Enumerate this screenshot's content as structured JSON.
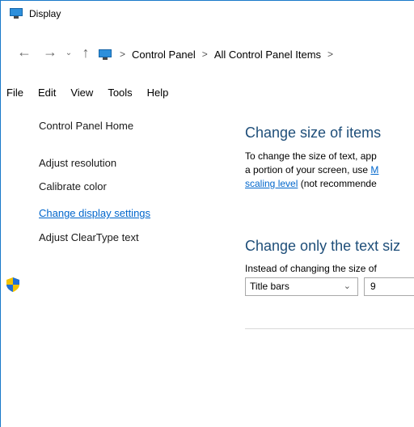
{
  "window": {
    "title": "Display"
  },
  "address": {
    "crumbs": [
      "Control Panel",
      "All Control Panel Items"
    ],
    "separator": ">"
  },
  "nav": {
    "back": "←",
    "forward": "→",
    "recent": "⌄",
    "up": "↑"
  },
  "menu": [
    "File",
    "Edit",
    "View",
    "Tools",
    "Help"
  ],
  "sidebar": {
    "home": "Control Panel Home",
    "items": [
      "Adjust resolution",
      "Calibrate color",
      "Change display settings",
      "Adjust ClearType text"
    ]
  },
  "main": {
    "section1": {
      "heading": "Change size of items",
      "line1": "To change the size of text, app",
      "line2_prefix": "a portion of your screen, use ",
      "line2_link": "M",
      "line3_link": "scaling level",
      "line3_suffix": " (not recommende"
    },
    "section2": {
      "heading": "Change only the text siz",
      "line1": "Instead of changing the size of"
    },
    "element_select": {
      "value": "Title bars"
    },
    "size_select": {
      "value": "9"
    }
  },
  "colors": {
    "accent": "#1979ca",
    "link": "#0066cc",
    "heading": "#1e4e79"
  }
}
